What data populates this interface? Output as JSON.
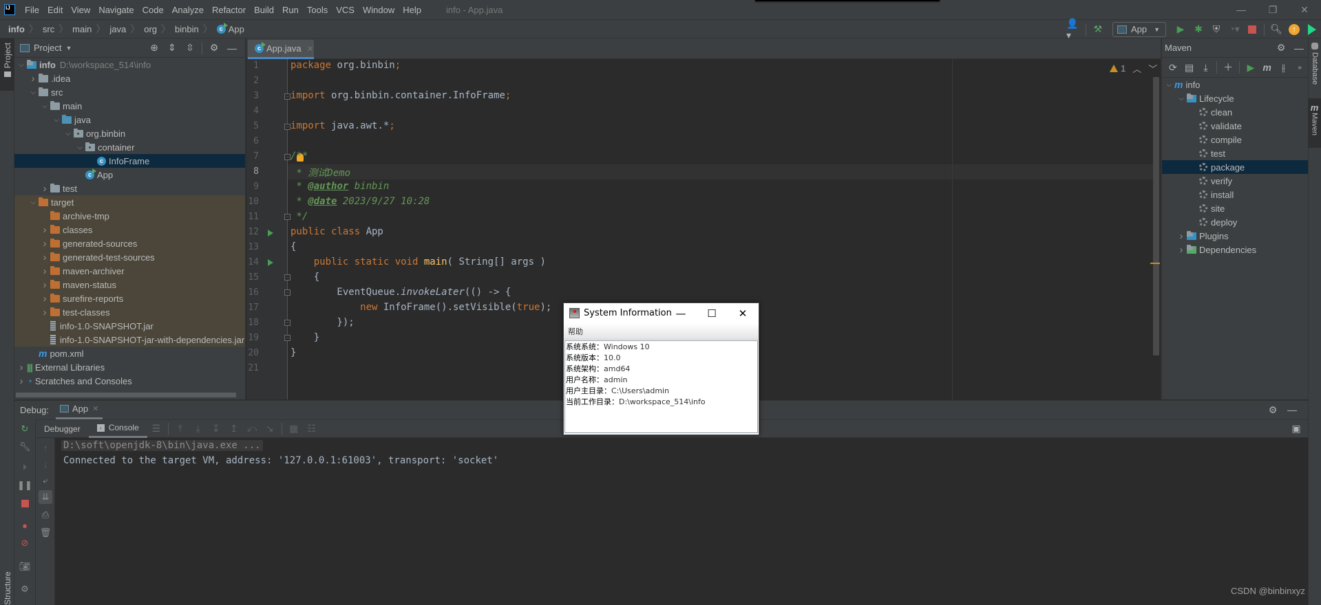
{
  "menubar": {
    "logo": "IJ",
    "items": [
      "File",
      "Edit",
      "View",
      "Navigate",
      "Code",
      "Analyze",
      "Refactor",
      "Build",
      "Run",
      "Tools",
      "VCS",
      "Window",
      "Help"
    ],
    "window_title": "info - App.java",
    "controls": {
      "minimize": "—",
      "restore": "❐",
      "close": "✕"
    }
  },
  "navbar": {
    "breadcrumbs": [
      "info",
      "src",
      "main",
      "java",
      "org",
      "binbin",
      "App"
    ],
    "run_config": "App",
    "icons": [
      "vcs-user-icon",
      "build-hammer-icon",
      "run-icon",
      "debug-icon",
      "coverage-icon",
      "profile-icon",
      "stop-icon",
      "search-icon",
      "update-icon",
      "toolbox-icon"
    ]
  },
  "left_stripe": {
    "project_label": "Project",
    "structure_label": "Structure"
  },
  "project_panel": {
    "title": "Project",
    "tree": [
      {
        "label": "info",
        "hint": "D:\\workspace_514\\info",
        "depth": 0,
        "expanded": true,
        "icon": "module",
        "bold": true
      },
      {
        "label": ".idea",
        "depth": 1,
        "expanded": false,
        "icon": "folder"
      },
      {
        "label": "src",
        "depth": 1,
        "expanded": true,
        "icon": "folder"
      },
      {
        "label": "main",
        "depth": 2,
        "expanded": true,
        "icon": "folder"
      },
      {
        "label": "java",
        "depth": 3,
        "expanded": true,
        "icon": "source-folder"
      },
      {
        "label": "org.binbin",
        "depth": 4,
        "expanded": true,
        "icon": "package"
      },
      {
        "label": "container",
        "depth": 5,
        "expanded": true,
        "icon": "package"
      },
      {
        "label": "InfoFrame",
        "depth": 6,
        "icon": "class",
        "selected": true
      },
      {
        "label": "App",
        "depth": 5,
        "icon": "class-runnable"
      },
      {
        "label": "test",
        "depth": 2,
        "expanded": false,
        "icon": "folder"
      },
      {
        "label": "target",
        "depth": 1,
        "expanded": true,
        "icon": "excluded-folder",
        "excluded": true
      },
      {
        "label": "archive-tmp",
        "depth": 2,
        "icon": "excluded-folder",
        "excluded": true,
        "leaf": true
      },
      {
        "label": "classes",
        "depth": 2,
        "expanded": false,
        "icon": "excluded-folder",
        "excluded": true
      },
      {
        "label": "generated-sources",
        "depth": 2,
        "expanded": false,
        "icon": "excluded-folder",
        "excluded": true
      },
      {
        "label": "generated-test-sources",
        "depth": 2,
        "expanded": false,
        "icon": "excluded-folder",
        "excluded": true
      },
      {
        "label": "maven-archiver",
        "depth": 2,
        "expanded": false,
        "icon": "excluded-folder",
        "excluded": true
      },
      {
        "label": "maven-status",
        "depth": 2,
        "expanded": false,
        "icon": "excluded-folder",
        "excluded": true
      },
      {
        "label": "surefire-reports",
        "depth": 2,
        "expanded": false,
        "icon": "excluded-folder",
        "excluded": true
      },
      {
        "label": "test-classes",
        "depth": 2,
        "expanded": false,
        "icon": "excluded-folder",
        "excluded": true
      },
      {
        "label": "info-1.0-SNAPSHOT.jar",
        "depth": 2,
        "icon": "jar",
        "excluded": true,
        "leaf": true
      },
      {
        "label": "info-1.0-SNAPSHOT-jar-with-dependencies.jar",
        "depth": 2,
        "icon": "jar",
        "excluded": true,
        "leaf": true
      },
      {
        "label": "pom.xml",
        "depth": 1,
        "icon": "maven",
        "leaf": true
      },
      {
        "label": "External Libraries",
        "depth": 0,
        "expanded": false,
        "icon": "libraries"
      },
      {
        "label": "Scratches and Consoles",
        "depth": 0,
        "expanded": false,
        "icon": "scratches"
      }
    ]
  },
  "editor": {
    "tab": {
      "label": "App.java"
    },
    "current_line": 8,
    "warnings": "1",
    "lines": [
      [
        {
          "t": "package ",
          "c": "kw"
        },
        {
          "t": "org.binbin",
          "c": ""
        },
        {
          "t": ";",
          "c": "kw"
        }
      ],
      [],
      [
        {
          "t": "import ",
          "c": "kw"
        },
        {
          "t": "org.binbin.container.InfoFrame",
          "c": ""
        },
        {
          "t": ";",
          "c": "kw"
        }
      ],
      [],
      [
        {
          "t": "import ",
          "c": "kw"
        },
        {
          "t": "java.awt.*",
          "c": ""
        },
        {
          "t": ";",
          "c": "kw"
        }
      ],
      [],
      [
        {
          "t": "/**",
          "c": "cm"
        }
      ],
      [
        {
          "t": " * 测试Demo",
          "c": "cm"
        }
      ],
      [
        {
          "t": " * ",
          "c": "cm"
        },
        {
          "t": "@author",
          "c": "tag"
        },
        {
          "t": " binbin",
          "c": "cm"
        }
      ],
      [
        {
          "t": " * ",
          "c": "cm"
        },
        {
          "t": "@date",
          "c": "tag"
        },
        {
          "t": " 2023/9/27 10:28",
          "c": "cm"
        }
      ],
      [
        {
          "t": " */",
          "c": "cm"
        }
      ],
      [
        {
          "t": "public class ",
          "c": "kw"
        },
        {
          "t": "App",
          "c": ""
        }
      ],
      [
        {
          "t": "{",
          "c": ""
        }
      ],
      [
        {
          "t": "    public static void ",
          "c": "kw"
        },
        {
          "t": "main",
          "c": "fn"
        },
        {
          "t": "( String[] args )",
          "c": ""
        }
      ],
      [
        {
          "t": "    {",
          "c": ""
        }
      ],
      [
        {
          "t": "        EventQueue.",
          "c": ""
        },
        {
          "t": "invokeLater",
          "c": "it"
        },
        {
          "t": "(() -> {",
          "c": ""
        }
      ],
      [
        {
          "t": "            new ",
          "c": "kw"
        },
        {
          "t": "InfoFrame().setVisible(",
          "c": ""
        },
        {
          "t": "true",
          "c": "kw"
        },
        {
          "t": ");",
          "c": ""
        }
      ],
      [
        {
          "t": "        });",
          "c": ""
        }
      ],
      [
        {
          "t": "    }",
          "c": ""
        }
      ],
      [
        {
          "t": "}",
          "c": ""
        }
      ],
      []
    ]
  },
  "maven_panel": {
    "title": "Maven",
    "tree": [
      {
        "label": "info",
        "depth": 0,
        "expanded": true,
        "icon": "maven-project"
      },
      {
        "label": "Lifecycle",
        "depth": 1,
        "expanded": true,
        "icon": "lifecycle-folder"
      },
      {
        "label": "clean",
        "depth": 2,
        "icon": "goal"
      },
      {
        "label": "validate",
        "depth": 2,
        "icon": "goal"
      },
      {
        "label": "compile",
        "depth": 2,
        "icon": "goal"
      },
      {
        "label": "test",
        "depth": 2,
        "icon": "goal"
      },
      {
        "label": "package",
        "depth": 2,
        "icon": "goal",
        "selected": true
      },
      {
        "label": "verify",
        "depth": 2,
        "icon": "goal"
      },
      {
        "label": "install",
        "depth": 2,
        "icon": "goal"
      },
      {
        "label": "site",
        "depth": 2,
        "icon": "goal"
      },
      {
        "label": "deploy",
        "depth": 2,
        "icon": "goal"
      },
      {
        "label": "Plugins",
        "depth": 1,
        "expanded": false,
        "icon": "plugins-folder"
      },
      {
        "label": "Dependencies",
        "depth": 1,
        "expanded": false,
        "icon": "dependencies-folder"
      }
    ]
  },
  "right_stripe": {
    "database_label": "Database",
    "maven_label": "Maven"
  },
  "debug": {
    "label": "Debug:",
    "tab": "App",
    "subtabs": [
      "Debugger",
      "Console"
    ],
    "active_subtab": "Console",
    "console_lines": [
      "D:\\soft\\openjdk-8\\bin\\java.exe ...",
      "Connected to the target VM, address: '127.0.0.1:61003', transport: 'socket'"
    ]
  },
  "dialog": {
    "title": "System Information",
    "menu": "帮助",
    "rows": [
      {
        "label": "系统系统：",
        "value": "Windows 10"
      },
      {
        "label": "系统版本：",
        "value": "10.0"
      },
      {
        "label": "系统架构：",
        "value": "amd64"
      },
      {
        "label": "用户名称：",
        "value": "admin"
      },
      {
        "label": "用户主目录：",
        "value": "C:\\Users\\admin"
      },
      {
        "label": "当前工作目录：",
        "value": "D:\\workspace_514\\info"
      }
    ],
    "controls": {
      "minimize": "—",
      "maximize": "☐",
      "close": "✕"
    }
  },
  "watermark": "CSDN @binbinxyz"
}
